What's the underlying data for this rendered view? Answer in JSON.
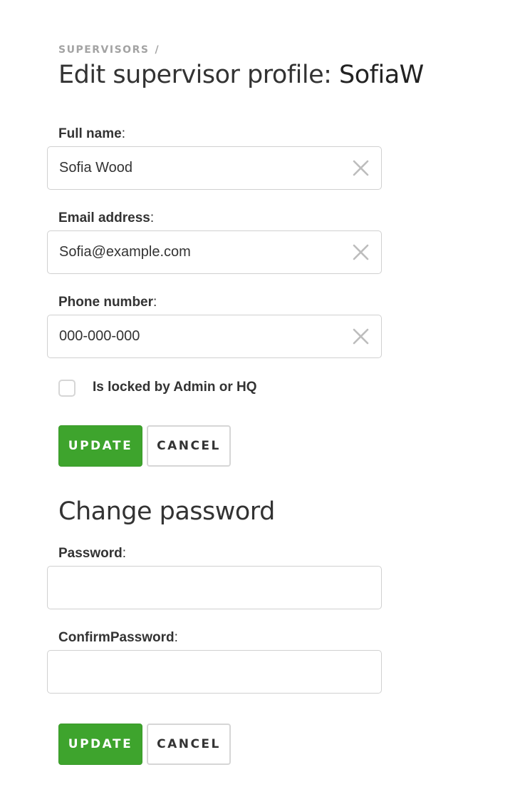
{
  "breadcrumb": {
    "parent": "SUPERVISORS",
    "separator": "/"
  },
  "title": {
    "prefix": "Edit supervisor profile: ",
    "username": "SofiaW"
  },
  "profile_form": {
    "full_name": {
      "label": "Full name",
      "value": "Sofia Wood"
    },
    "email": {
      "label": "Email address",
      "value": "Sofia@example.com"
    },
    "phone": {
      "label": "Phone number",
      "value": "000-000-000"
    },
    "locked_checkbox": {
      "label": "Is locked by Admin or HQ",
      "checked": false
    },
    "update_label": "UPDATE",
    "cancel_label": "CANCEL"
  },
  "password_form": {
    "title": "Change password",
    "password": {
      "label": "Password",
      "value": ""
    },
    "confirm_password": {
      "label": "ConfirmPassword",
      "value": ""
    },
    "update_label": "UPDATE",
    "cancel_label": "CANCEL"
  },
  "colors": {
    "accent_green": "#3ea42d",
    "border": "#d0d0d0",
    "muted_text": "#a3a3a3"
  },
  "icons": {
    "clear": "close-icon"
  }
}
